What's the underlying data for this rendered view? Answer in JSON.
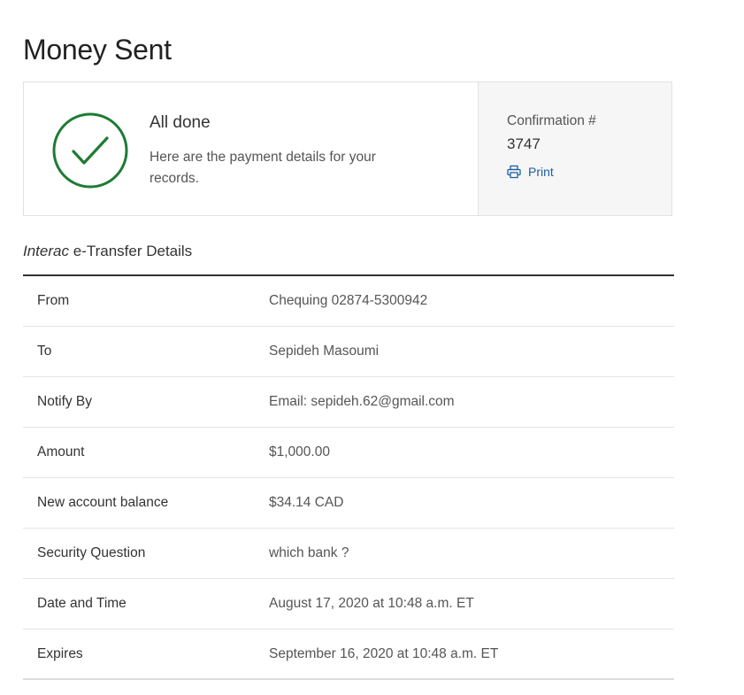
{
  "page": {
    "title": "Money Sent"
  },
  "summary": {
    "done_title": "All done",
    "done_desc": "Here are the payment details for your records.",
    "confirmation_label": "Confirmation #",
    "confirmation_number": "3747",
    "print_label": "Print",
    "check_color": "#1e7b34",
    "icons": {
      "status": "check-circle-icon",
      "print": "printer-icon"
    }
  },
  "details": {
    "title_italic": "Interac",
    "title_rest": " e-Transfer Details",
    "rows": [
      {
        "label": "From",
        "value": "Chequing 02874-5300942"
      },
      {
        "label": "To",
        "value": "Sepideh Masoumi"
      },
      {
        "label": "Notify By",
        "value": "Email: sepideh.62@gmail.com"
      },
      {
        "label": "Amount",
        "value": "$1,000.00"
      },
      {
        "label": "New account balance",
        "value": "$34.14 CAD"
      },
      {
        "label": "Security Question",
        "value": "which bank ?"
      },
      {
        "label": "Date and Time",
        "value": "August 17, 2020 at 10:48 a.m. ET"
      },
      {
        "label": "Expires",
        "value": "September 16, 2020 at 10:48 a.m. ET"
      }
    ]
  }
}
